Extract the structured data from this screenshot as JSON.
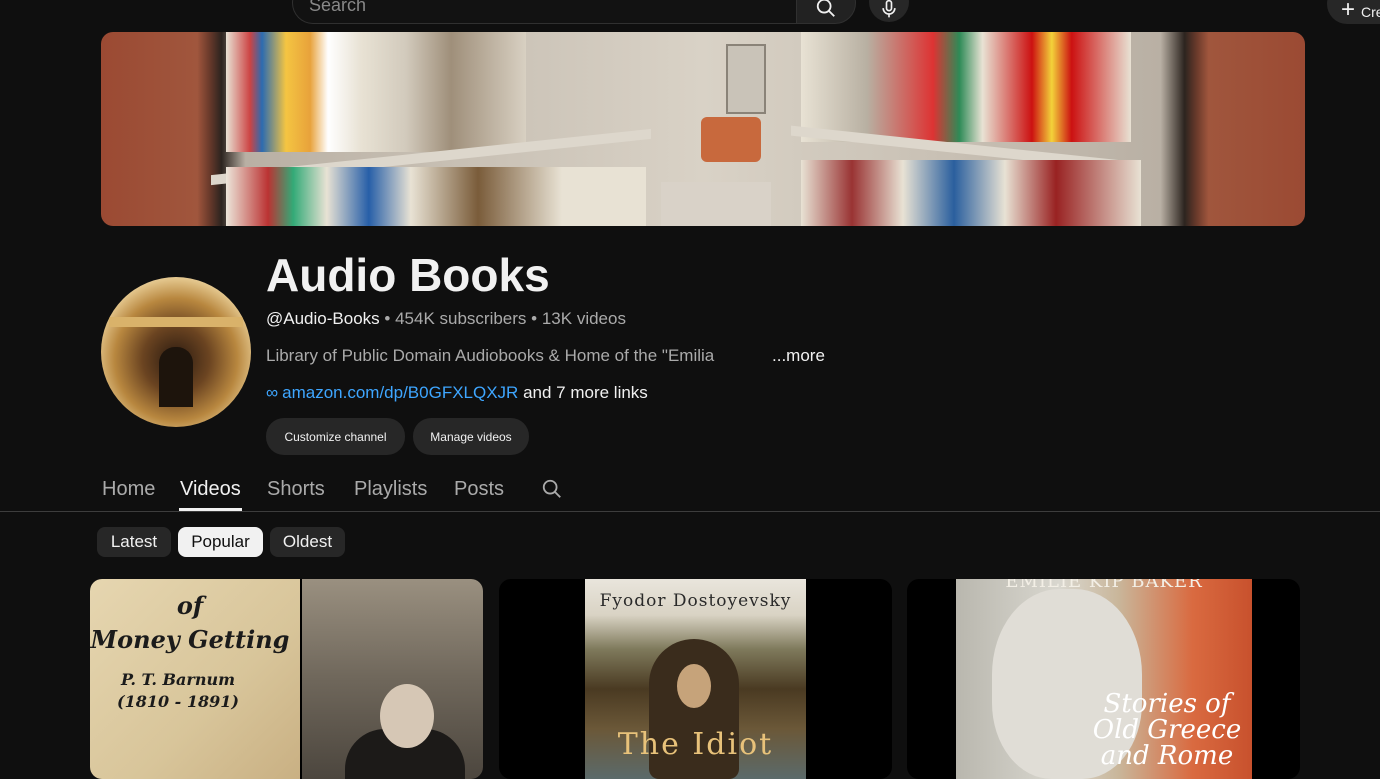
{
  "topbar": {
    "search_placeholder": "Search",
    "create_label": "Create"
  },
  "channel": {
    "title": "Audio Books",
    "handle": "@Audio-Books",
    "subscribers": "454K subscribers",
    "videos": "13K videos",
    "separator": "•",
    "description": "Library of Public Domain Audiobooks & Home of the \"Emilia",
    "more_label": "...more",
    "link_icon": "∞",
    "link_url": "amazon.com/dp/B0GFXLQXJR",
    "more_links": "and 7 more links",
    "customize_label": "Customize channel",
    "manage_label": "Manage videos"
  },
  "tabs": [
    {
      "label": "Home"
    },
    {
      "label": "Videos"
    },
    {
      "label": "Shorts"
    },
    {
      "label": "Playlists"
    },
    {
      "label": "Posts"
    }
  ],
  "chips": [
    {
      "label": "Latest"
    },
    {
      "label": "Popular"
    },
    {
      "label": "Oldest"
    }
  ],
  "videos": [
    {
      "lines": [
        "of",
        "Money Getting",
        "P. T. Barnum",
        "(1810 - 1891)"
      ]
    },
    {
      "author": "Fyodor Dostoyevsky",
      "title": "The Idiot"
    },
    {
      "author": "EMILIE KIP BAKER",
      "title_lines": [
        "Stories of",
        "Old Greece",
        "and Rome"
      ]
    }
  ],
  "colors": {
    "background": "#0f0f0f",
    "link": "#3ea6ff",
    "chip_active": "#f1f1f1",
    "chip": "#272727"
  }
}
